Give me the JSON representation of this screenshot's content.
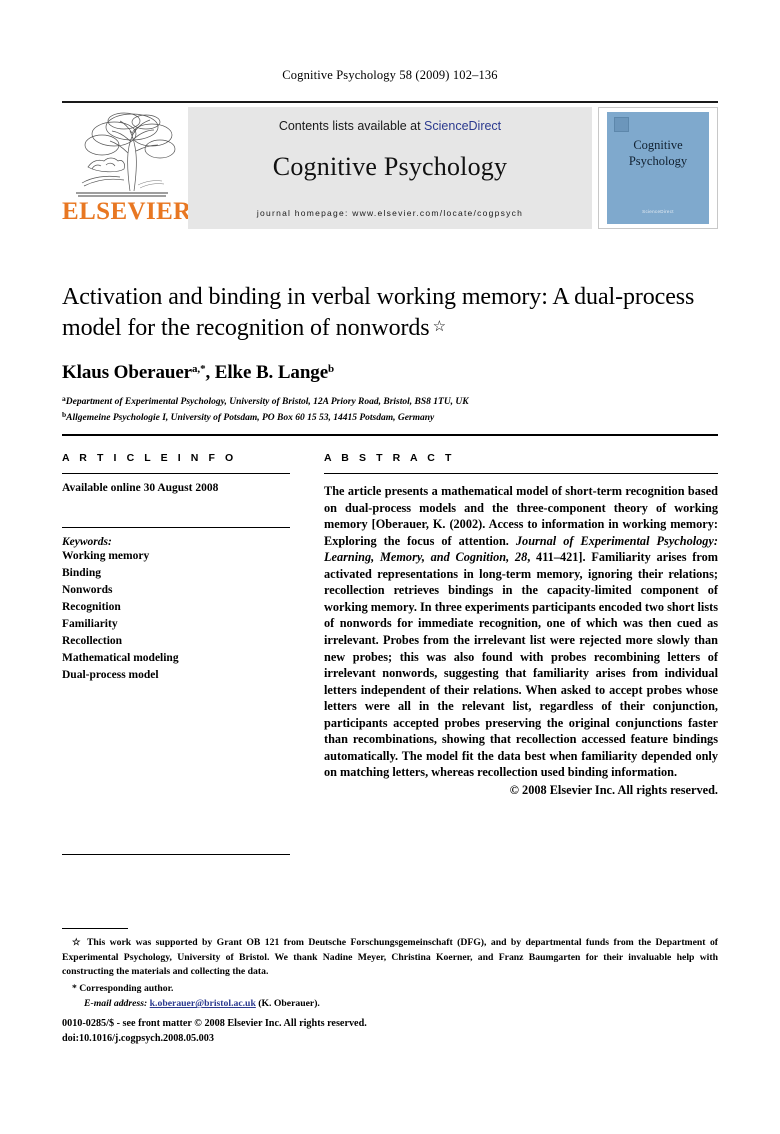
{
  "running_head": "Cognitive Psychology 58 (2009) 102–136",
  "masthead": {
    "contents_prefix": "Contents lists available at ",
    "sciencedirect": "ScienceDirect",
    "journal_title": "Cognitive Psychology",
    "homepage": "journal homepage: www.elsevier.com/locate/cogpsych",
    "publisher_wordmark": "ELSEVIER",
    "cover": {
      "title_line1": "Cognitive",
      "title_line2": "Psychology",
      "footer_mark": "ScienceDirect",
      "background_color": "#7fa9cd"
    },
    "link_color": "#2b3a8f",
    "box_color": "#e6e6e6",
    "wordmark_color": "#E87722"
  },
  "article": {
    "title": "Activation and binding in verbal working memory: A dual-process model for the recognition of nonwords",
    "title_footnote_marker": "☆",
    "authors": [
      {
        "name": "Klaus Oberauer",
        "marks": "a,*"
      },
      {
        "name": "Elke B. Lange",
        "marks": "b"
      }
    ],
    "affiliations": [
      {
        "mark": "a",
        "text": "Department of Experimental Psychology, University of Bristol, 12A Priory Road, Bristol, BS8 1TU, UK"
      },
      {
        "mark": "b",
        "text": "Allgemeine Psychologie I, University of Potsdam, PO Box 60 15 53, 14415 Potsdam, Germany"
      }
    ]
  },
  "info": {
    "heading": "A R T I C L E   I N F O",
    "history": "Available online 30 August 2008",
    "keywords_label": "Keywords:",
    "keywords": [
      "Working memory",
      "Binding",
      "Nonwords",
      "Recognition",
      "Familiarity",
      "Recollection",
      "Mathematical modeling",
      "Dual-process model"
    ]
  },
  "abstract": {
    "heading": "A B S T R A C T",
    "part1": "The article presents a mathematical model of short-term recognition based on dual-process models and the three-component theory of working memory [Oberauer, K. (2002). Access to information in working memory: Exploring the focus of attention. ",
    "citation_italic": "Journal of Experimental Psychology: Learning, Memory, and Cognition, 28",
    "part2": ", 411–421]. Familiarity arises from activated representations in long-term memory, ignoring their relations; recollection retrieves bindings in the capacity-limited component of working memory. In three experiments participants encoded two short lists of nonwords for immediate recognition, one of which was then cued as irrelevant. Probes from the irrelevant list were rejected more slowly than new probes; this was also found with probes recombining letters of irrelevant nonwords, suggesting that familiarity arises from individual letters independent of their relations. When asked to accept probes whose letters were all in the relevant list, regardless of their conjunction, participants accepted probes preserving the original conjunctions faster than recombinations, showing that recollection accessed feature bindings automatically. The model fit the data best when familiarity depended only on matching letters, whereas recollection used binding information.",
    "copyright": "© 2008 Elsevier Inc. All rights reserved."
  },
  "footnotes": {
    "funding_marker": "☆",
    "funding": "This work was supported by Grant OB 121 from Deutsche Forschungsgemeinschaft (DFG), and by departmental funds from the Department of Experimental Psychology, University of Bristol. We thank Nadine Meyer, Christina Koerner, and Franz Baumgarten for their invaluable help with constructing the materials and collecting the data.",
    "corresponding_marker": "*",
    "corresponding": "Corresponding author.",
    "email_label": "E-mail address:",
    "email": "k.oberauer@bristol.ac.uk",
    "email_owner": "(K. Oberauer).",
    "email_color": "#2b3a8f"
  },
  "footer": {
    "issn_line": "0010-0285/$ - see front matter © 2008 Elsevier Inc. All rights reserved.",
    "doi_line": "doi:10.1016/j.cogpsych.2008.05.003"
  }
}
